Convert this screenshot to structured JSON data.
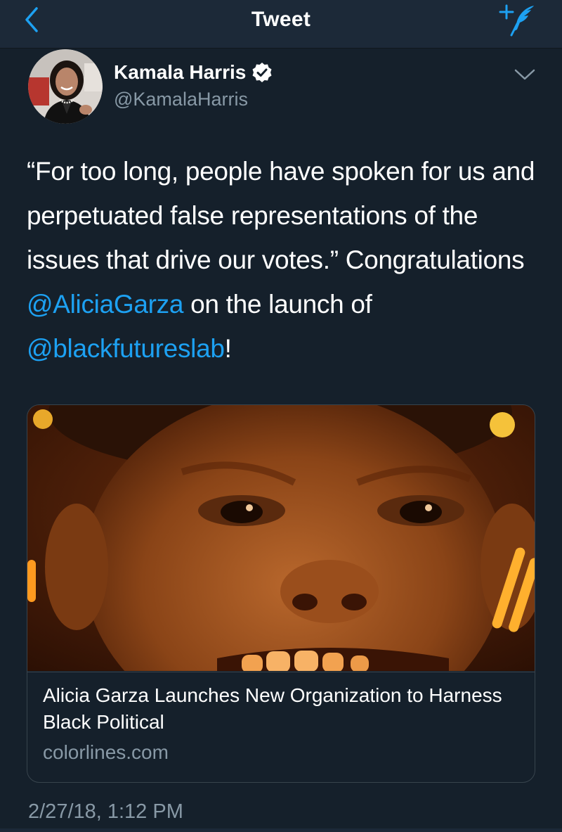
{
  "navbar": {
    "title": "Tweet",
    "back_icon": "chevron-left-icon",
    "compose_icon": "compose-tweet-icon",
    "accent": "#1da1f2"
  },
  "author": {
    "display_name": "Kamala Harris",
    "handle": "@KamalaHarris",
    "verified": true
  },
  "tweet": {
    "text_1": "“For too long, people have spoken for us and perpetuated false representations of the issues that drive our votes.” Congratulations ",
    "mention_1": "@AliciaGarza",
    "text_2": " on the launch of ",
    "mention_2": "@blackfutureslab",
    "text_3": "!",
    "timestamp": "2/27/18, 1:12 PM"
  },
  "card": {
    "title": "Alicia Garza Launches New Organization to Harness Black Political",
    "domain": "colorlines.com"
  },
  "colors": {
    "background": "#15202b",
    "navbar": "#1c2938",
    "secondary_text": "#8899a6",
    "link": "#1da1f2",
    "border": "#38444d"
  }
}
